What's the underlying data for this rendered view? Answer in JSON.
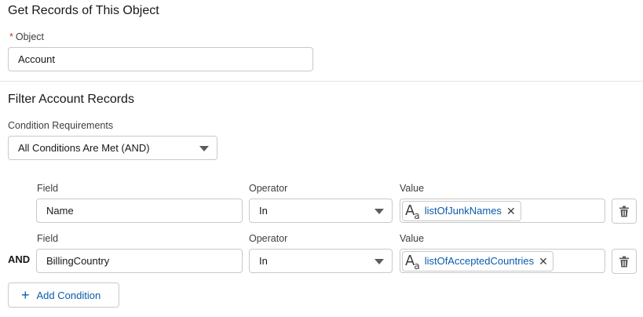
{
  "get_records": {
    "title": "Get Records of This Object",
    "object_required_marker": "*",
    "object_label": "Object",
    "object_value": "Account"
  },
  "filter": {
    "title": "Filter Account Records",
    "condition_label": "Condition Requirements",
    "condition_value": "All Conditions Are Met (AND)",
    "rows": [
      {
        "prefix": "",
        "field_label": "Field",
        "field_value": "Name",
        "operator_label": "Operator",
        "operator_value": "In",
        "value_label": "Value",
        "value_resource": "listOfJunkNames",
        "value_icon": "text-resource-icon"
      },
      {
        "prefix": "AND",
        "field_label": "Field",
        "field_value": "BillingCountry",
        "operator_label": "Operator",
        "operator_value": "In",
        "value_label": "Value",
        "value_resource": "listOfAcceptedCountries",
        "value_icon": "text-resource-icon"
      }
    ],
    "add_condition_label": "Add Condition"
  },
  "icons": {
    "remove": "close-icon",
    "delete": "trash-icon",
    "add": "plus-icon",
    "dropdown": "chevron-down-icon"
  },
  "colors": {
    "link_blue": "#0b5cab",
    "required_red": "#c23934",
    "border": "#c9c9c9"
  }
}
